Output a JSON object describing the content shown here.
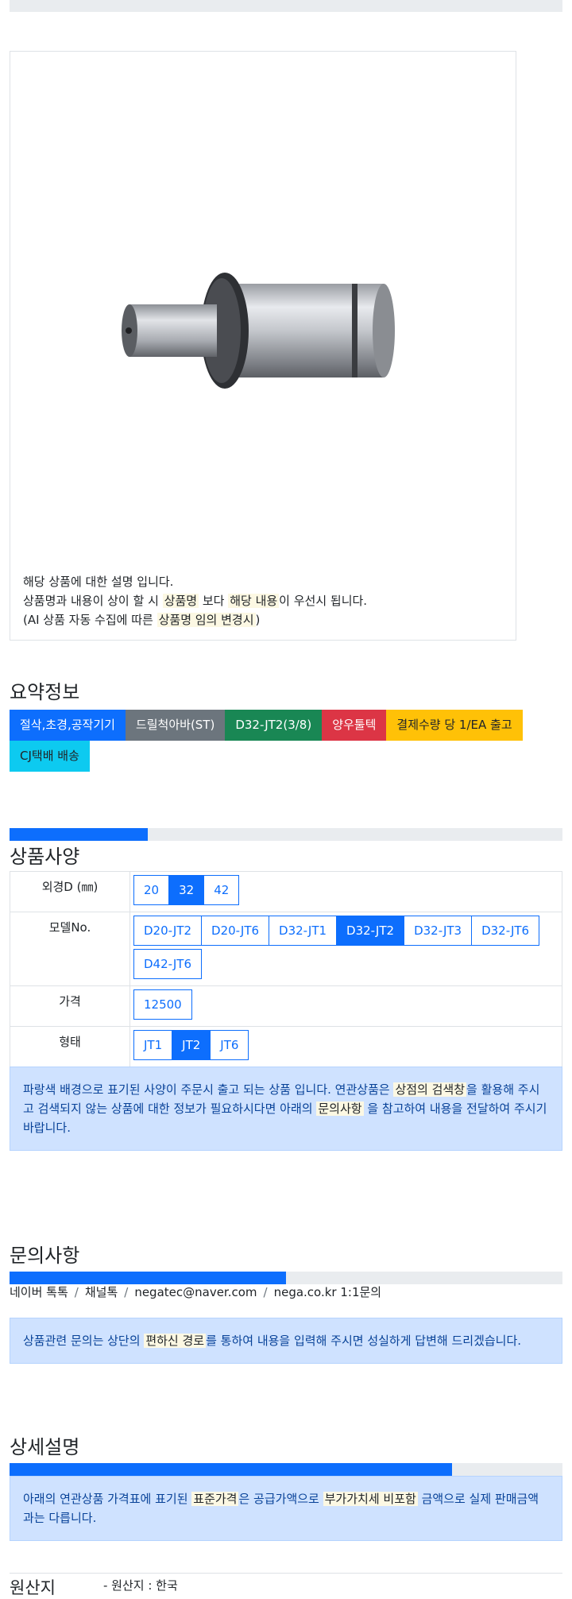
{
  "image_desc": {
    "line1": "해당 상품에 대한 설명 입니다.",
    "line2_pre": "상품명과 내용이 상이 할 시 ",
    "line2_mark1": "상품명",
    "line2_mid": " 보다 ",
    "line2_mark2": "해당 내용",
    "line2_post": "이 우선시 됩니다.",
    "line3_pre": "(AI 상품 자동 수집에 따른 ",
    "line3_mark": "상품명 임의 변경시",
    "line3_post": ")"
  },
  "summary": {
    "title": "요약정보",
    "badges": [
      "절삭,초경,공작기기",
      "드릴척아바(ST)",
      "D32-JT2(3/8)",
      "양우툴텍",
      "결제수량 당 1/EA 출고",
      "CJ택배 배송"
    ]
  },
  "spec": {
    "title": "상품사양",
    "progress_fraction": 0.25,
    "rows": [
      {
        "label": "외경D (㎜)",
        "options": [
          "20",
          "32",
          "42"
        ],
        "active": 1
      },
      {
        "label": "모델No.",
        "options": [
          "D20-JT2",
          "D20-JT6",
          "D32-JT1",
          "D32-JT2",
          "D32-JT3",
          "D32-JT6",
          "D42-JT6"
        ],
        "active": 3
      },
      {
        "label": "가격",
        "options": [
          "12500"
        ],
        "active": -1
      },
      {
        "label": "형태",
        "options": [
          "JT1",
          "JT2",
          "JT6"
        ],
        "active": 1
      }
    ],
    "alert_pre": "파랑색 배경으로 표기된 사양이 주문시 출고 되는 상품 입니다. 연관상품은 ",
    "alert_mark1": "상점의 검색창",
    "alert_mid": "을 활용해 주시고 검색되지 않는 상품에 대한 정보가 필요하시다면 아래의 ",
    "alert_mark2": "문의사항",
    "alert_post": " 을 참고하여 내용을 전달하여 주시기 바랍니다."
  },
  "inquiry": {
    "title": "문의사항",
    "progress_fraction": 0.5,
    "links": [
      "네이버 톡톡",
      "채널톡",
      "negatec@naver.com",
      "nega.co.kr 1:1문의"
    ],
    "alert_pre": "상품관련 문의는 상단의 ",
    "alert_mark": "편하신 경로",
    "alert_post": "를 통하여 내용을 입력해 주시면 성실하게 답변해 드리겠습니다."
  },
  "detail": {
    "title": "상세설명",
    "progress_fraction": 0.8,
    "alert_pre": "아래의 연관상품 가격표에 표기된 ",
    "alert_mark1": "표준가격",
    "alert_mid": "은 공급가액으로 ",
    "alert_mark2": "부가가치세 비포함",
    "alert_post": " 금액으로 실제 판매금액과는 다릅니다."
  },
  "origin": {
    "label": "원산지",
    "value": "- 원산지 : 한국"
  },
  "colors": {
    "primary": "#0d6efd",
    "alert_bg": "#cfe2ff",
    "mark_bg": "#fcf8e3"
  }
}
